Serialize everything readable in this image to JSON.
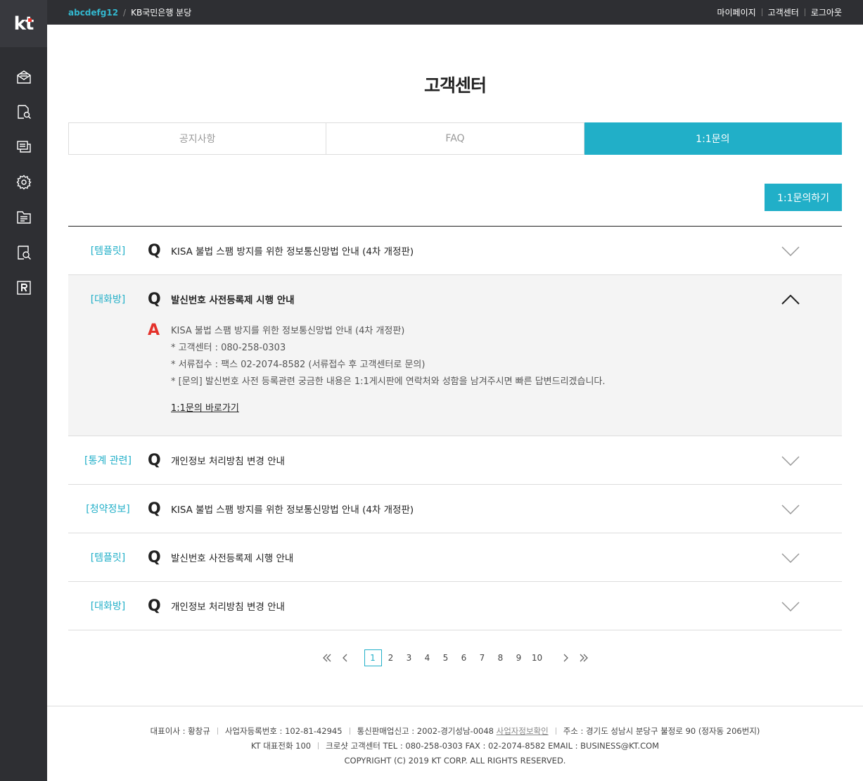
{
  "topbar": {
    "user_id": "abcdefg12",
    "separator": "/",
    "company": "KB국민은행 분당",
    "links": [
      "마이페이지",
      "고객센터",
      "로그아웃"
    ]
  },
  "logo": {
    "text": "kt"
  },
  "sidebar": {
    "icons": [
      "mail-icon",
      "document-search-icon",
      "chat-windows-icon",
      "gear-icon",
      "folder-list-icon",
      "file-search-icon",
      "r-box-icon"
    ]
  },
  "page": {
    "title": "고객센터"
  },
  "tabs": [
    {
      "label": "공지사항",
      "active": false
    },
    {
      "label": "FAQ",
      "active": false
    },
    {
      "label": "1:1문의",
      "active": true
    }
  ],
  "ask_button": "1:1문의하기",
  "faq": [
    {
      "category": "[템플릿]",
      "q_mark": "Q",
      "question": "KISA 불법 스팸 방지를 위한 정보통신망법 안내 (4차 개정판)",
      "open": false
    },
    {
      "category": "[대화방]",
      "q_mark": "Q",
      "question": "발신번호 사전등록제 시행 안내",
      "open": true,
      "a_mark": "A",
      "answer_lines": [
        "KISA 불법 스팸 방지를 위한 정보통신망법 안내 (4차 개정판)",
        "* 고객센터 : 080-258-0303",
        "* 서류접수 : 팩스 02-2074-8582 (서류접수 후 고객센터로 문의)",
        "* [문의] 발신번호 사전 등록관련 궁금한 내용은 1:1게시판에 연락처와 성함을 남겨주시면 빠른 답변드리겠습니다."
      ],
      "answer_link": "1:1문의 바로가기"
    },
    {
      "category": "[통계 관련]",
      "q_mark": "Q",
      "question": "개인정보 처리방침 변경 안내",
      "open": false
    },
    {
      "category": "[청약정보]",
      "q_mark": "Q",
      "question": "KISA 불법 스팸 방지를 위한 정보통신망법 안내 (4차 개정판)",
      "open": false
    },
    {
      "category": "[템플릿]",
      "q_mark": "Q",
      "question": "발신번호 사전등록제 시행 안내",
      "open": false
    },
    {
      "category": "[대화방]",
      "q_mark": "Q",
      "question": "개인정보 처리방침 변경 안내",
      "open": false
    }
  ],
  "pagination": {
    "pages": [
      "1",
      "2",
      "3",
      "4",
      "5",
      "6",
      "7",
      "8",
      "9",
      "10"
    ],
    "current": "1"
  },
  "footer": {
    "line1": [
      "대표이사 : 황창규",
      "사업자등록번호 : 102-81-42945",
      "통신판매업신고 : 2002-경기성남-0048",
      "사업자정보확인",
      "주소 : 경기도 성남시 분당구 불정로 90 (정자동 206번지)"
    ],
    "line2": [
      "KT 대표전화 100",
      "크로샷 고객센터 TEL : 080-258-0303 FAX : 02-2074-8582 EMAIL : BUSINESS@KT.COM"
    ],
    "copyright": "COPYRIGHT (C) 2019 KT CORP. ALL RIGHTS RESERVED."
  },
  "colors": {
    "accent": "#21afc8",
    "sidebar": "#2e2f33",
    "answer_mark": "#e4322b"
  }
}
